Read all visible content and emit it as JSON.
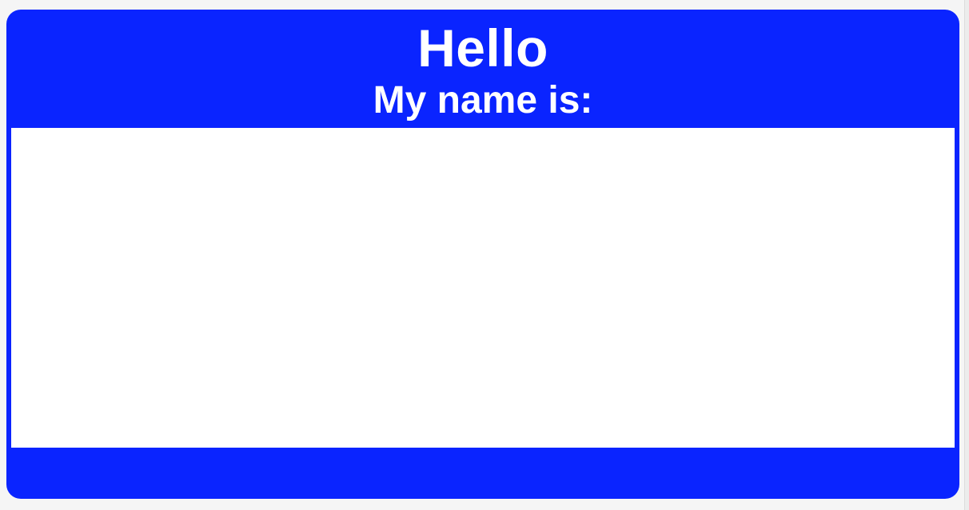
{
  "badge": {
    "greeting": "Hello",
    "subtitle": "My name is:",
    "name_value": "",
    "accent_color": "#0a24ff",
    "text_color": "#ffffff",
    "field_color": "#ffffff"
  }
}
